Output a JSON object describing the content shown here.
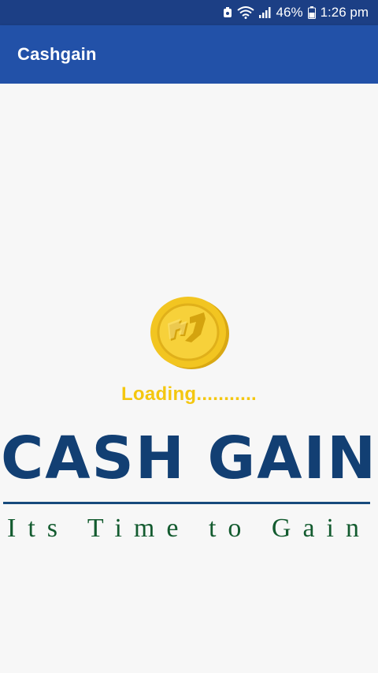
{
  "status_bar": {
    "battery_percent": "46%",
    "time": "1:26 pm"
  },
  "app_bar": {
    "title": "Cashgain"
  },
  "splash": {
    "loading_text": "Loading...........",
    "logo_text": "CASH GAIN",
    "tagline": "Its Time to Gain",
    "coin_icon": "rupee-coin-icon",
    "colors": {
      "status_bar": "#1c3f85",
      "app_bar": "#2251a8",
      "loading": "#f4c70f",
      "logo": "#123f73",
      "tagline": "#135b2f",
      "coin": "#f2c521"
    }
  }
}
